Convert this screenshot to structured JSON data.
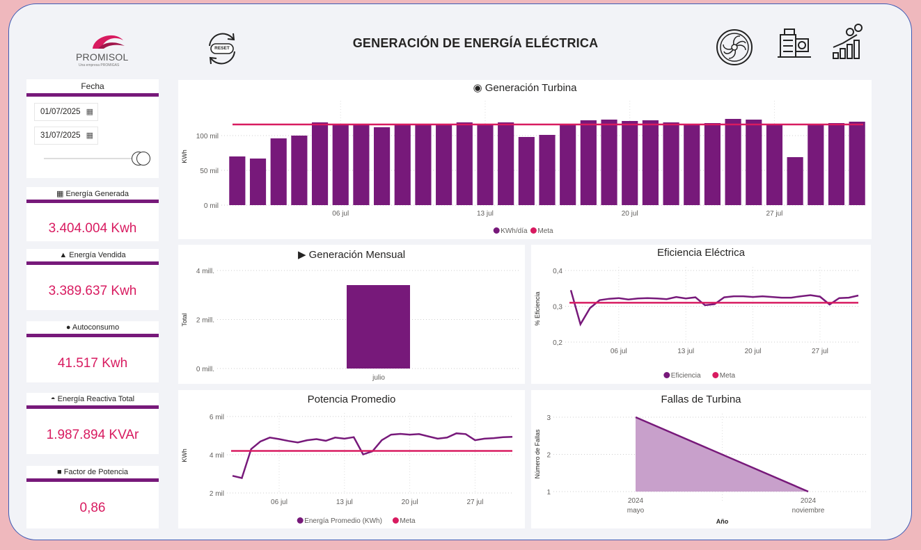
{
  "header": {
    "title": "GENERACIÓN DE ENERGÍA ELÉCTRICA",
    "logo_brand": "PROMISOL",
    "logo_tagline": "Una empresa PROMIGAS",
    "reset_label": "RESET",
    "icons": [
      "turbine-icon",
      "generator-icon",
      "growth-chart-gear-icon"
    ]
  },
  "filters": {
    "title": "Fecha",
    "start_date": "01/07/2025",
    "end_date": "31/07/2025"
  },
  "kpis": [
    {
      "label": "Energía Generada",
      "icon": "▦",
      "value": "3.404.004 Kwh"
    },
    {
      "label": "Energía Vendida",
      "icon": "▲",
      "value": "3.389.637 Kwh"
    },
    {
      "label": "Autoconsumo",
      "icon": "●",
      "value": "41.517 Kwh"
    },
    {
      "label": "Energía Reactiva Total",
      "icon": "◓",
      "value": "1.987.894 KVAr"
    },
    {
      "label": "Factor de Potencia",
      "icon": "■",
      "value": "0,86"
    }
  ],
  "colors": {
    "primary": "#77197a",
    "accent": "#d81b60",
    "kpi_value": "#d81b60",
    "background": "#f2f3f7",
    "page": "#efb8bd"
  },
  "chart_data": [
    {
      "id": "turbine",
      "type": "bar",
      "title": "◉ Generación Turbina",
      "ylabel": "KWh",
      "ylim": [
        0,
        140000
      ],
      "yticks": [
        0,
        50000,
        100000
      ],
      "ytick_labels": [
        "0 mil",
        "50 mil",
        "100 mil"
      ],
      "xtick_labels": [
        {
          "day": 6,
          "label": "06 jul"
        },
        {
          "day": 13,
          "label": "13 jul"
        },
        {
          "day": 20,
          "label": "20 jul"
        },
        {
          "day": 27,
          "label": "27 jul"
        }
      ],
      "x": [
        1,
        2,
        3,
        4,
        5,
        6,
        7,
        8,
        9,
        10,
        11,
        12,
        13,
        14,
        15,
        16,
        17,
        18,
        19,
        20,
        21,
        22,
        23,
        24,
        25,
        26,
        27,
        28,
        29,
        30,
        31
      ],
      "series": [
        {
          "name": "KWh/día",
          "type": "bar",
          "values": [
            70000,
            67000,
            96000,
            100000,
            119000,
            117000,
            115000,
            112000,
            116000,
            117000,
            115000,
            119000,
            117000,
            119000,
            98000,
            101000,
            115000,
            122000,
            123000,
            121000,
            122000,
            119000,
            116000,
            118000,
            124000,
            123000,
            115000,
            69000,
            117000,
            118000,
            120000
          ]
        },
        {
          "name": "Meta",
          "type": "line",
          "value": 116000
        }
      ],
      "legend": "bottom-center"
    },
    {
      "id": "monthly",
      "type": "bar",
      "title": "▶ Generación Mensual",
      "ylabel": "Total",
      "ylim": [
        0,
        4000000
      ],
      "yticks": [
        0,
        2000000,
        4000000
      ],
      "ytick_labels": [
        "0 mill.",
        "2 mill.",
        "4 mill."
      ],
      "categories": [
        "julio"
      ],
      "values": [
        3404004
      ]
    },
    {
      "id": "efficiency",
      "type": "line",
      "title": "Eficiencia Eléctrica",
      "ylabel": "% Eficiencia",
      "ylim": [
        0.2,
        0.4
      ],
      "yticks": [
        0.2,
        0.3,
        0.4
      ],
      "ytick_labels": [
        "0,2",
        "0,3",
        "0,4"
      ],
      "xtick_labels": [
        {
          "day": 6,
          "label": "06 jul"
        },
        {
          "day": 13,
          "label": "13 jul"
        },
        {
          "day": 20,
          "label": "20 jul"
        },
        {
          "day": 27,
          "label": "27 jul"
        }
      ],
      "x": [
        1,
        2,
        3,
        4,
        5,
        6,
        7,
        8,
        9,
        10,
        11,
        12,
        13,
        14,
        15,
        16,
        17,
        18,
        19,
        20,
        21,
        22,
        23,
        24,
        25,
        26,
        27,
        28,
        29,
        30,
        31
      ],
      "series": [
        {
          "name": "Eficiencia",
          "values": [
            0.345,
            0.25,
            0.295,
            0.317,
            0.321,
            0.323,
            0.319,
            0.322,
            0.323,
            0.322,
            0.32,
            0.326,
            0.322,
            0.325,
            0.303,
            0.306,
            0.325,
            0.328,
            0.328,
            0.326,
            0.328,
            0.326,
            0.324,
            0.324,
            0.328,
            0.331,
            0.327,
            0.305,
            0.323,
            0.324,
            0.33
          ]
        },
        {
          "name": "Meta",
          "value": 0.31
        }
      ],
      "legend": "bottom-center"
    },
    {
      "id": "power",
      "type": "line",
      "title": "Potencia Promedio",
      "ylabel": "KWh",
      "ylim": [
        2000,
        6000
      ],
      "yticks": [
        2000,
        4000,
        6000
      ],
      "ytick_labels": [
        "2 mil",
        "4 mil",
        "6 mil"
      ],
      "xtick_labels": [
        {
          "day": 6,
          "label": "06 jul"
        },
        {
          "day": 13,
          "label": "13 jul"
        },
        {
          "day": 20,
          "label": "20 jul"
        },
        {
          "day": 27,
          "label": "27 jul"
        }
      ],
      "x": [
        1,
        2,
        3,
        4,
        5,
        6,
        7,
        8,
        9,
        10,
        11,
        12,
        13,
        14,
        15,
        16,
        17,
        18,
        19,
        20,
        21,
        22,
        23,
        24,
        25,
        26,
        27,
        28,
        29,
        30,
        31
      ],
      "series": [
        {
          "name": "Energía Promedio (KWh)",
          "values": [
            2900,
            2780,
            4300,
            4700,
            4900,
            4820,
            4720,
            4640,
            4760,
            4820,
            4730,
            4900,
            4840,
            4920,
            4020,
            4180,
            4760,
            5050,
            5090,
            5050,
            5080,
            4960,
            4840,
            4900,
            5120,
            5080,
            4760,
            4840,
            4870,
            4920,
            4940
          ]
        },
        {
          "name": "Meta",
          "value": 4200
        }
      ],
      "legend": "bottom-center"
    },
    {
      "id": "faults",
      "type": "area",
      "title": "Fallas de Turbina",
      "xlabel": "Año",
      "ylabel": "Número de Fallas",
      "ylim": [
        1,
        3
      ],
      "yticks": [
        1,
        2,
        3
      ],
      "ytick_labels": [
        "1",
        "2",
        "3"
      ],
      "categories": [
        {
          "year": "2024",
          "month": "mayo"
        },
        {
          "year": "2024",
          "month": "noviembre"
        }
      ],
      "values": [
        3,
        1
      ]
    }
  ]
}
